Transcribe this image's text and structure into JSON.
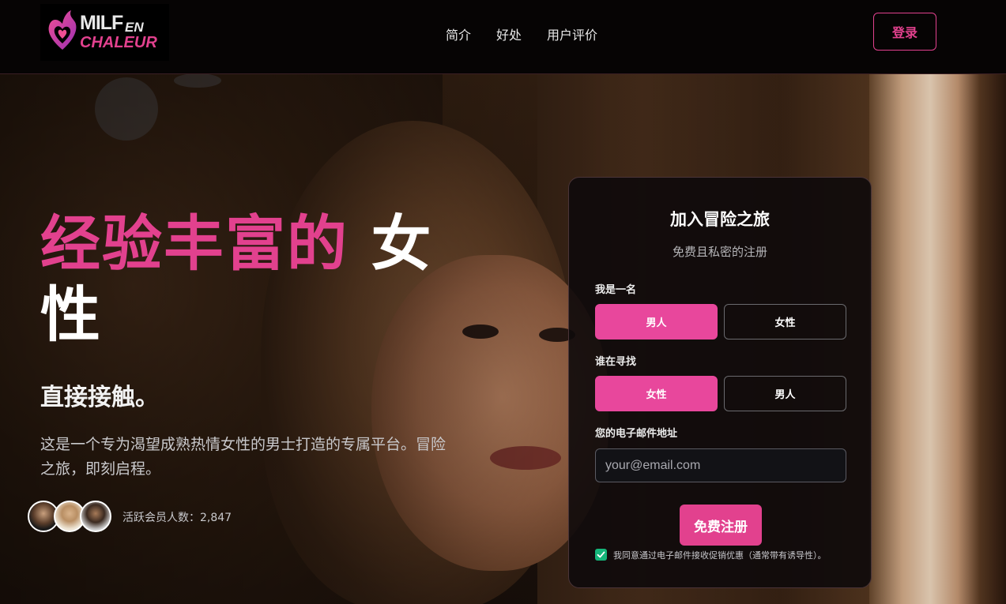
{
  "header": {
    "logo": {
      "line1": "MILF",
      "line1_suffix": "EN",
      "line2": "CHALEUR"
    },
    "nav": [
      "简介",
      "好处",
      "用户评价"
    ],
    "login_label": "登录"
  },
  "hero": {
    "headline_pink": "经验丰富的",
    "headline_white": "女性",
    "subheadline": "直接接触。",
    "description": "这是一个专为渴望成熟热情女性的男士打造的专属平台。冒险之旅，即刻启程。",
    "member_count_text": "活跃会员人数：2,847"
  },
  "form": {
    "title": "加入冒险之旅",
    "subtitle": "免费且私密的注册",
    "i_am_label": "我是一名",
    "i_am_options": [
      {
        "label": "男人",
        "selected": true
      },
      {
        "label": "女性",
        "selected": false
      }
    ],
    "seeking_label": "谁在寻找",
    "seeking_options": [
      {
        "label": "女性",
        "selected": true
      },
      {
        "label": "男人",
        "selected": false
      }
    ],
    "email_label": "您的电子邮件地址",
    "email_placeholder": "your@email.com",
    "email_value": "",
    "submit_label": "免费注册",
    "consent_checked": true,
    "consent_text": "我同意通过电子邮件接收促销优惠（通常带有诱导性）。"
  },
  "colors": {
    "accent": "#e2418e",
    "option_active": "#e8479c",
    "checkbox": "#15b57a"
  },
  "icons": [
    "flame-heart-logo-icon",
    "checkmark-icon"
  ]
}
